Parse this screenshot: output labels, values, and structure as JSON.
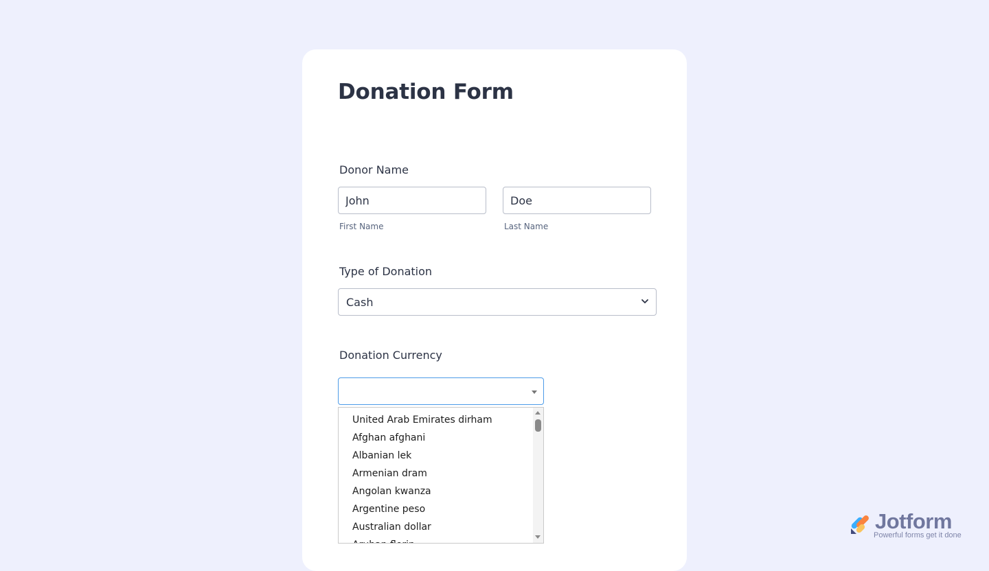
{
  "form": {
    "title": "Donation Form"
  },
  "donor_name": {
    "label": "Donor Name",
    "first_value": "John",
    "first_sublabel": "First Name",
    "last_value": "Doe",
    "last_sublabel": "Last Name"
  },
  "donation_type": {
    "label": "Type of Donation",
    "selected": "Cash",
    "icon": "chevron-down-icon"
  },
  "currency": {
    "label": "Donation Currency",
    "value": "",
    "icon": "caret-down-icon",
    "options": [
      "United Arab Emirates dirham",
      "Afghan afghani",
      "Albanian lek",
      "Armenian dram",
      "Angolan kwanza",
      "Argentine peso",
      "Australian dollar",
      "Aruban florin"
    ]
  },
  "branding": {
    "logo_name": "Jotform",
    "tagline": "Powerful forms get it done"
  },
  "colors": {
    "page_background": "#eef0fd",
    "card_background": "#ffffff",
    "text": "#2c3345",
    "focus_border": "#4c9be8",
    "input_border": "#b8bdc9"
  }
}
